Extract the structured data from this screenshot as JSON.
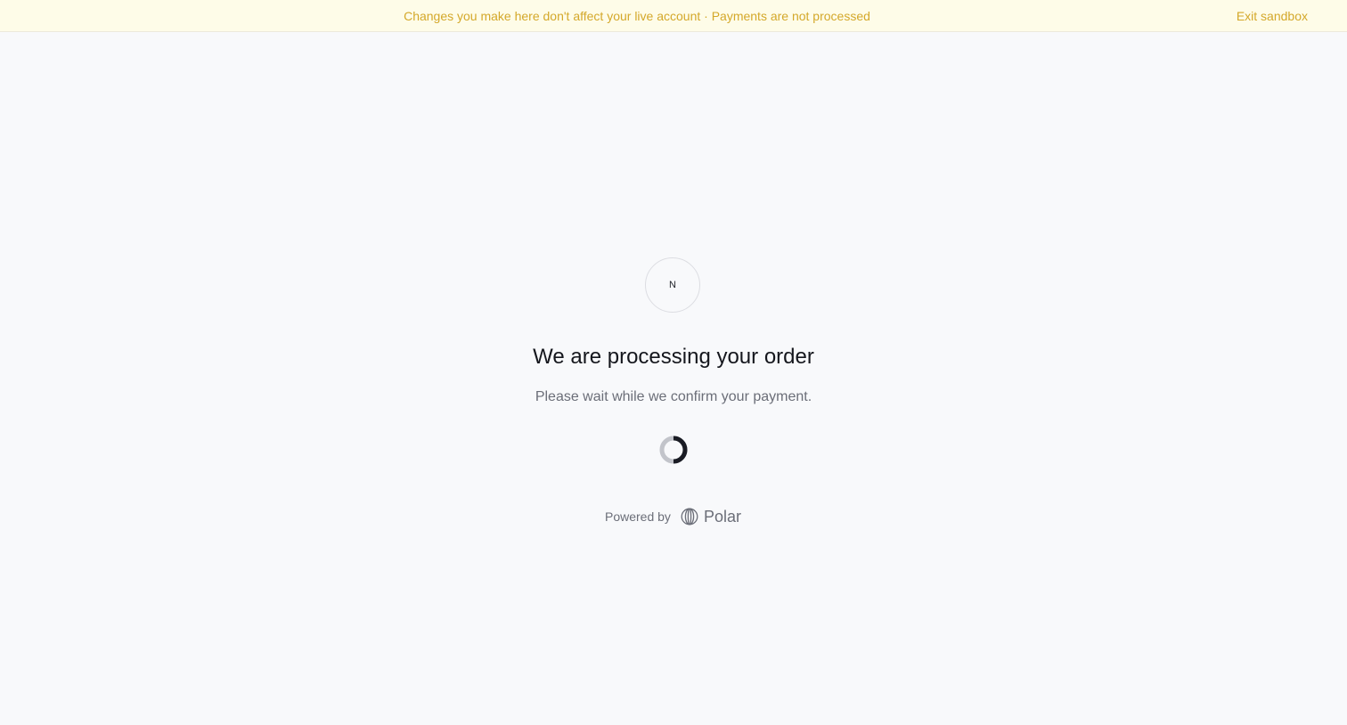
{
  "banner": {
    "message": "Changes you make here don't affect your live account · Payments are not processed",
    "exit_label": "Exit sandbox"
  },
  "avatar": {
    "initial": "N"
  },
  "status": {
    "title": "We are processing your order",
    "subtitle": "Please wait while we confirm your payment."
  },
  "spinner": {
    "icon": "loading-spinner-icon"
  },
  "footer": {
    "powered_label": "Powered by",
    "brand_name": "Polar",
    "brand_icon": "polar-logo-icon"
  },
  "colors": {
    "banner_bg": "#fefce8",
    "banner_text": "#d4a82a",
    "page_bg": "#f8f9fb",
    "title": "#15171d",
    "muted": "#6b6e78"
  }
}
